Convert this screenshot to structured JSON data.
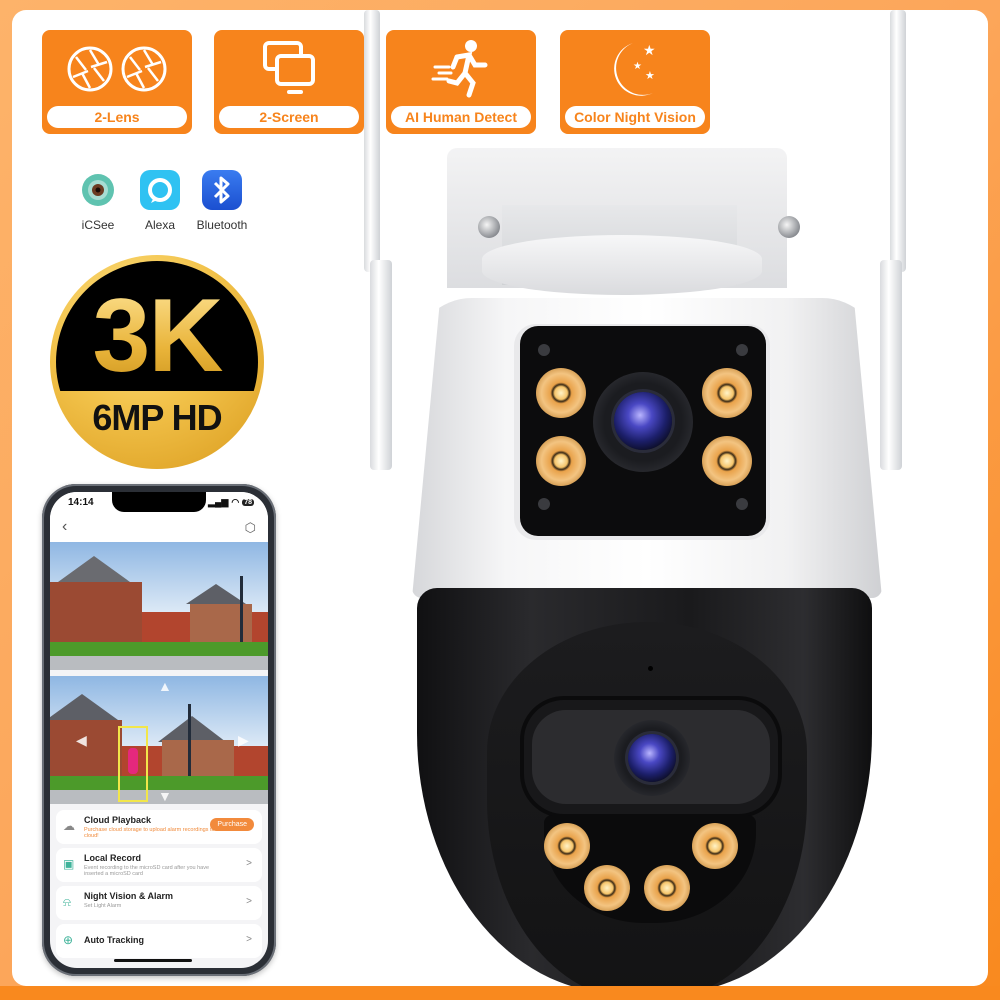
{
  "features": [
    {
      "label": "2-Lens",
      "icon": "aperture-icon"
    },
    {
      "label": "2-Screen",
      "icon": "dual-monitor-icon"
    },
    {
      "label": "AI Human Detect",
      "icon": "running-person-icon"
    },
    {
      "label": "Color Night Vision",
      "icon": "moon-stars-icon"
    }
  ],
  "apps": [
    {
      "name": "iCSee",
      "icon": "icsee-icon"
    },
    {
      "name": "Alexa",
      "icon": "alexa-icon"
    },
    {
      "name": "Bluetooth",
      "icon": "bluetooth-icon"
    }
  ],
  "resolution_badge": {
    "main": "3K",
    "sub": "6MP HD"
  },
  "phone": {
    "status_time": "14:14",
    "battery": "78",
    "menu": [
      {
        "title": "Cloud Playback",
        "subtitle": "Purchase cloud storage to upload alarm recordings to cloud!",
        "action": "Purchase"
      },
      {
        "title": "Local Record",
        "subtitle": "Event recording to the microSD card after you have inserted a microSD card",
        "action": ">"
      },
      {
        "title": "Night Vision & Alarm",
        "subtitle": "Set Light Alarm",
        "action": ">"
      },
      {
        "title": "Auto Tracking",
        "subtitle": "",
        "action": ">"
      }
    ]
  },
  "colors": {
    "brand_orange": "#f7841c",
    "frame_peach": "#fdb36a",
    "gold": "#f2c24a"
  }
}
